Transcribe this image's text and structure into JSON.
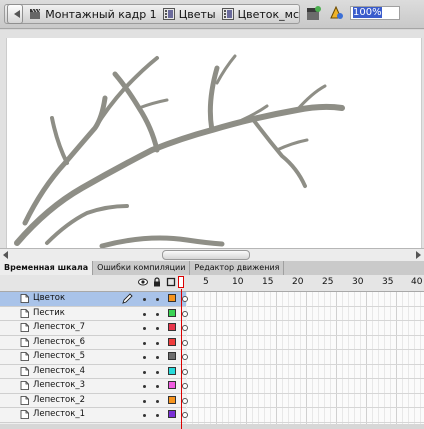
{
  "breadcrumb": {
    "items": [
      {
        "label": "Монтажный кадр 1",
        "icon": "scene-clapper-icon"
      },
      {
        "label": "Цветы",
        "icon": "movieclip-icon"
      },
      {
        "label": "Цветок_мс",
        "icon": "movieclip-icon"
      }
    ]
  },
  "toolbar": {
    "zoom_value": "100%"
  },
  "panel_tabs": [
    {
      "label": "Временная шкала",
      "active": true
    },
    {
      "label": "Ошибки компиляции",
      "active": false
    },
    {
      "label": "Редактор движения",
      "active": false
    }
  ],
  "timeline": {
    "frame_numbers": [
      "5",
      "10",
      "15",
      "20",
      "25",
      "30",
      "35",
      "40"
    ],
    "current_frame_marker": "1",
    "layers": [
      {
        "name": "Цветок",
        "color": "#f7941d",
        "selected": true
      },
      {
        "name": "Пестик",
        "color": "#39d353",
        "selected": false
      },
      {
        "name": "Лепесток_7",
        "color": "#e8364b",
        "selected": false
      },
      {
        "name": "Лепесток_6",
        "color": "#f03d3d",
        "selected": false
      },
      {
        "name": "Лепесток_5",
        "color": "#6d6d6d",
        "selected": false
      },
      {
        "name": "Лепесток_4",
        "color": "#26d9d9",
        "selected": false
      },
      {
        "name": "Лепесток_3",
        "color": "#f05be0",
        "selected": false
      },
      {
        "name": "Лепесток_2",
        "color": "#f7941d",
        "selected": false
      },
      {
        "name": "Лепесток_1",
        "color": "#7a2fd6",
        "selected": false
      }
    ]
  },
  "colors": {
    "branch": "#8e8e86",
    "selection": "#a9c3e9",
    "playhead": "#dd0000"
  }
}
